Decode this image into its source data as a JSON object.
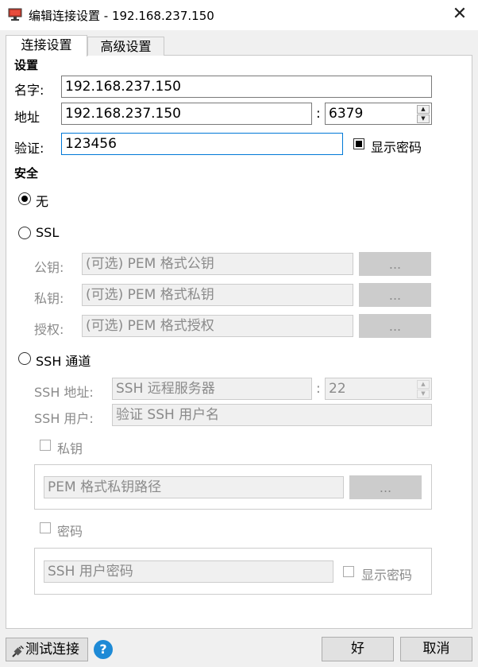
{
  "window": {
    "title": "编辑连接设置 - 192.168.237.150",
    "app_icon": "monitor-icon",
    "close_glyph": "✕"
  },
  "tabs": [
    {
      "label": "连接设置",
      "active": true
    },
    {
      "label": "高级设置",
      "active": false
    }
  ],
  "settings": {
    "section_label": "设置",
    "name_label": "名字:",
    "name_value": "192.168.237.150",
    "address_label": "地址",
    "address_value": "192.168.237.150",
    "port_separator": ":",
    "port_value": "6379",
    "auth_label": "验证:",
    "auth_value": "123456",
    "show_password_label": "显示密码",
    "show_password_checked": true
  },
  "security": {
    "section_label": "安全",
    "options": [
      {
        "label": "无",
        "selected": true
      },
      {
        "label": "SSL",
        "selected": false
      },
      {
        "label": "SSH 通道",
        "selected": false
      }
    ],
    "ssl": {
      "public_key_label": "公钥:",
      "public_key_placeholder": "(可选) PEM 格式公钥",
      "private_key_label": "私钥:",
      "private_key_placeholder": "(可选) PEM 格式私钥",
      "authority_label": "授权:",
      "authority_placeholder": "(可选) PEM 格式授权",
      "browse_label": "..."
    },
    "ssh": {
      "address_label": "SSH 地址:",
      "address_placeholder": "SSH 远程服务器",
      "port_separator": ":",
      "port_value": "22",
      "user_label": "SSH 用户:",
      "user_placeholder": "验证 SSH 用户名",
      "private_key_checkbox_label": "私钥",
      "private_key_path_placeholder": "PEM 格式私钥路径",
      "browse_label": "...",
      "password_checkbox_label": "密码",
      "password_placeholder": "SSH 用户密码",
      "show_password_label": "显示密码"
    }
  },
  "footer": {
    "test_connection_label": "测试连接",
    "help_glyph": "?",
    "ok_label": "好",
    "cancel_label": "取消"
  },
  "colors": {
    "accent": "#0078d7",
    "help_icon": "#1e8ad6",
    "disabled_text": "#8a8a8a"
  }
}
